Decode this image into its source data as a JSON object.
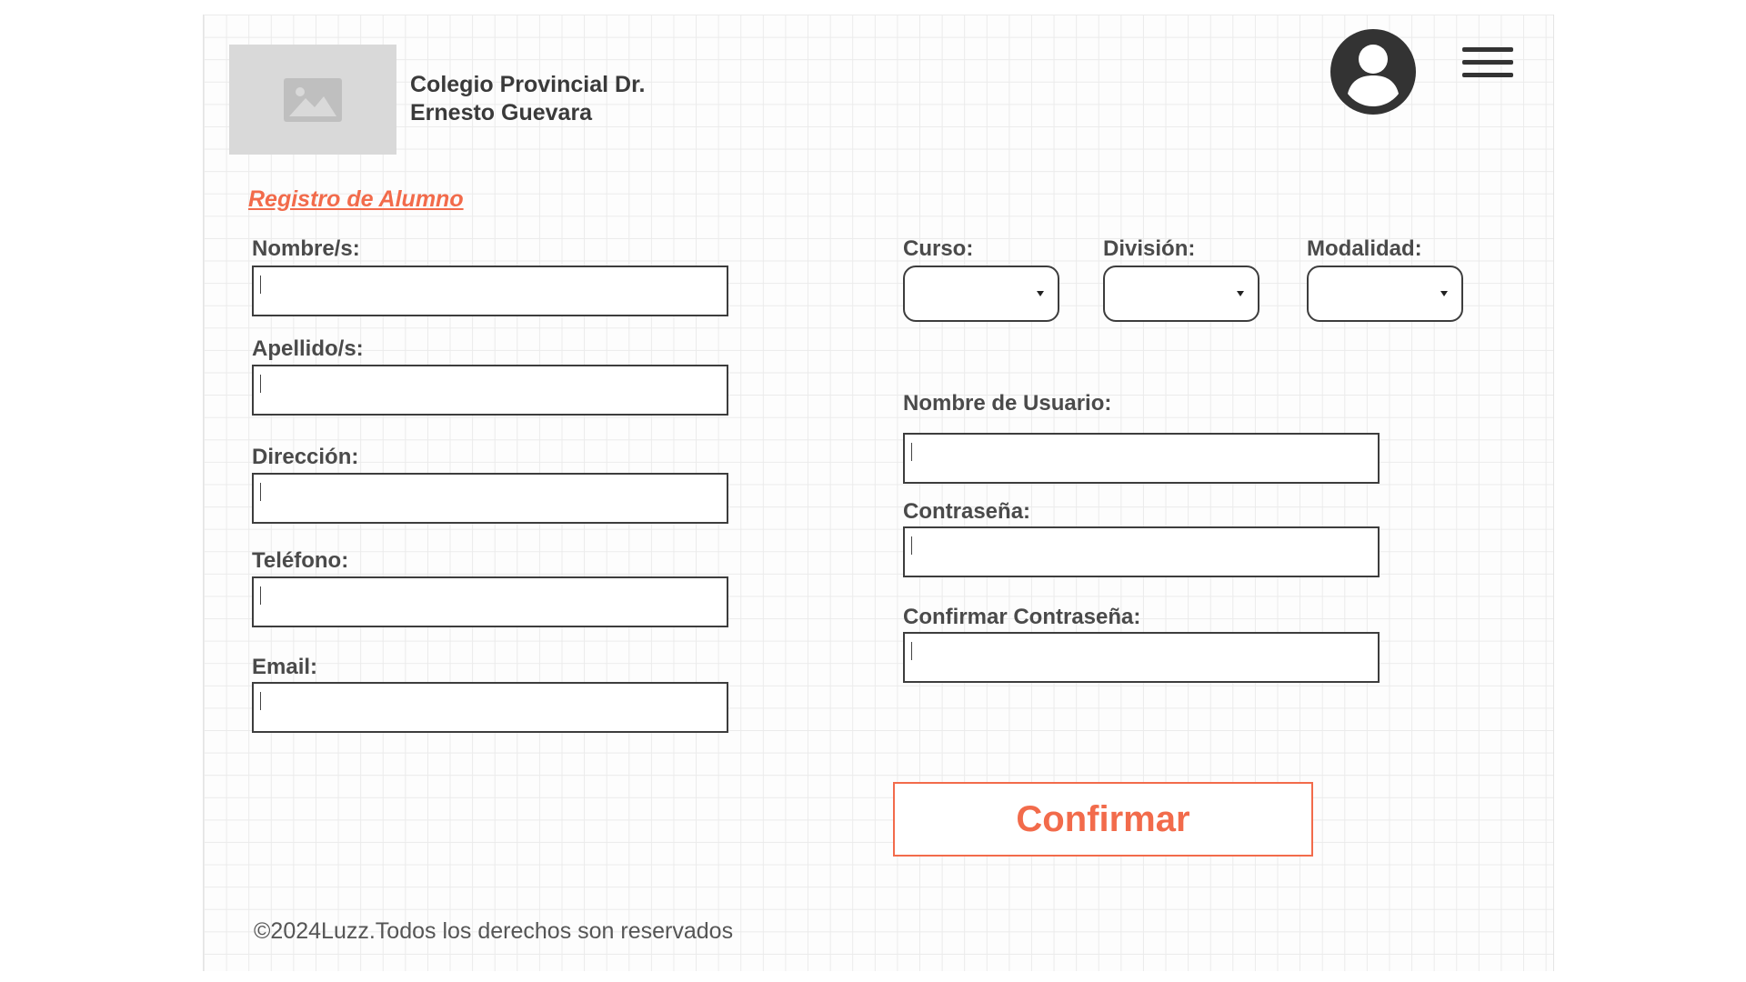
{
  "header": {
    "logo_icon": "image-placeholder-icon",
    "school_line1": "Colegio Provincial Dr.",
    "school_line2": "Ernesto Guevara",
    "avatar_icon": "user-circle-icon",
    "menu_icon": "hamburger-menu-icon"
  },
  "form": {
    "title": "Registro de Alumno",
    "left_fields": [
      {
        "label": "Nombre/s:",
        "value": ""
      },
      {
        "label": "Apellido/s:",
        "value": ""
      },
      {
        "label": "Dirección:",
        "value": ""
      },
      {
        "label": "Teléfono:",
        "value": ""
      },
      {
        "label": "Email:",
        "value": ""
      }
    ],
    "selects": [
      {
        "label": "Curso:",
        "value": ""
      },
      {
        "label": "División:",
        "value": ""
      },
      {
        "label": "Modalidad:",
        "value": ""
      }
    ],
    "right_fields": [
      {
        "label": "Nombre de Usuario:",
        "value": ""
      },
      {
        "label": "Contraseña:",
        "value": ""
      },
      {
        "label": "Confirmar Contraseña:",
        "value": ""
      }
    ],
    "confirm_label": "Confirmar"
  },
  "footer": {
    "text": "©2024Luzz.Todos los derechos son reservados"
  },
  "colors": {
    "accent": "#f26b4b",
    "border": "#3d3d3d",
    "logo_bg": "#d9d9d9",
    "avatar": "#333333"
  }
}
